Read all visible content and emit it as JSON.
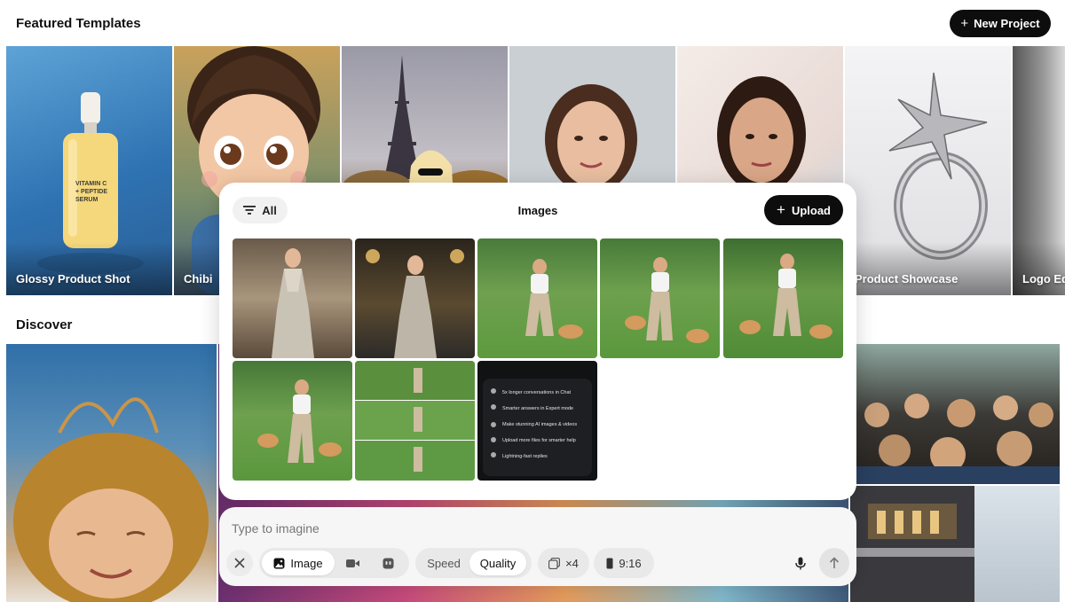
{
  "featured": {
    "title": "Featured Templates",
    "new_project_label": "New Project",
    "tiles": [
      {
        "label": "Glossy Product Shot"
      },
      {
        "label": "Chibi"
      },
      {
        "label": ""
      },
      {
        "label": ""
      },
      {
        "label": ""
      },
      {
        "label": "Product Showcase"
      },
      {
        "label": "Logo Ed"
      }
    ],
    "serum_bottle": {
      "line1": "VITAMIN C",
      "line2": "+ PEPTIDE",
      "line3": "SERUM"
    }
  },
  "discover": {
    "title": "Discover"
  },
  "panel": {
    "filter_label": "All",
    "title": "Images",
    "upload_label": "Upload",
    "promo_items": [
      "5x longer conversations in Chat",
      "Smarter answers in Expert mode",
      "Make stunning AI images & videos",
      "Upload more files for smarter help",
      "Lightning-fast replies"
    ]
  },
  "prompt": {
    "placeholder": "Type to imagine",
    "mode_image": "Image",
    "speed_label": "Speed",
    "quality_label": "Quality",
    "count_label": "×4",
    "ratio_label": "9:16"
  },
  "colors": {
    "accent_dark": "#0d0d0d",
    "pill_bg": "#e9e9e9"
  }
}
